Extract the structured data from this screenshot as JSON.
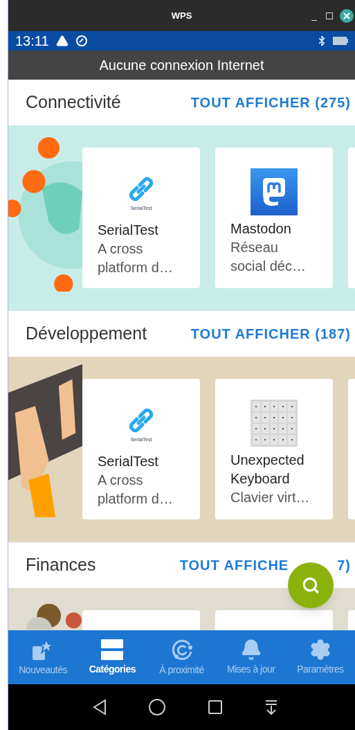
{
  "window": {
    "title": "WPS"
  },
  "status_bar": {
    "time": "13:11"
  },
  "offline_banner": "Aucune connexion Internet",
  "categories": [
    {
      "name": "Connectivité",
      "show_all": "TOUT AFFICHER (275)",
      "color": "#c8ede9",
      "apps": [
        {
          "kind": "link",
          "icon_caption": "SerialTest",
          "name": "SerialTest",
          "description": "A cross platform d…"
        },
        {
          "kind": "mastodon",
          "name": "Mastodon",
          "description": "Réseau social déc…"
        }
      ]
    },
    {
      "name": "Développement",
      "show_all": "TOUT AFFICHER (187)",
      "color": "#e1d5bb",
      "apps": [
        {
          "kind": "link",
          "icon_caption": "SerialTest",
          "name": "SerialTest",
          "description": "A cross platform d…"
        },
        {
          "kind": "keyboard",
          "name": "Unexpected Keyboard",
          "description": "Clavier virt…"
        }
      ]
    },
    {
      "name": "Finances",
      "show_all": "TOUT AFFICHE",
      "count_tail": "7)",
      "color": "#e0ddd0"
    }
  ],
  "bottom_nav": [
    {
      "kind": "star",
      "label": "Nouveautés",
      "selected": false
    },
    {
      "kind": "categories",
      "label": "Catégories",
      "selected": true
    },
    {
      "kind": "nearby",
      "label": "À proximité",
      "selected": false
    },
    {
      "kind": "bell",
      "label": "Mises à jour",
      "selected": false
    },
    {
      "kind": "gear",
      "label": "Paramètres",
      "selected": false
    }
  ]
}
